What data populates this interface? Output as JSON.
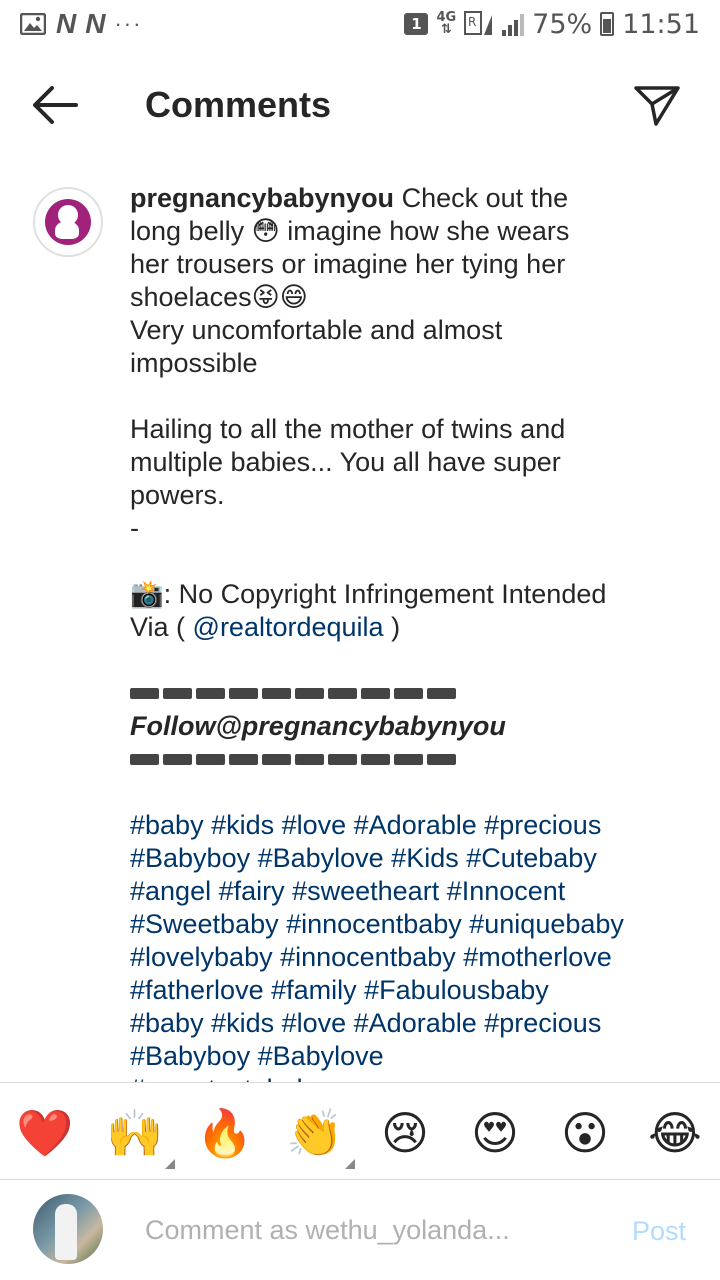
{
  "status_bar": {
    "notif_badge": "1",
    "network": "4G",
    "battery": "75%",
    "time": "11:51",
    "n_icon": "N"
  },
  "header": {
    "title": "Comments",
    "back_icon": "arrow-left-icon",
    "send_icon": "paper-plane-icon"
  },
  "comment": {
    "username": "pregnancybabynyou",
    "lines": [
      " Check out the",
      "long belly 😳 imagine how she wears",
      "her trousers or imagine her tying her",
      "shoelaces😝😄",
      "Very uncomfortable and almost",
      "impossible",
      "",
      "Hailing to all the mother of twins and",
      "multiple babies... You all have super",
      "powers.",
      "-",
      "",
      "📸: No Copyright Infringement Intended"
    ],
    "via_prefix": "Via ( ",
    "via_mention": "@realtordequila",
    "via_suffix": " )",
    "follow": "Follow@pregnancybabynyou",
    "hashtags": [
      " #baby #kids #love #Adorable #precious",
      "#Babyboy #Babylove #Kids #Cutebaby",
      "#angel #fairy #sweetheart #Innocent",
      "#Sweetbaby #innocentbaby #uniquebaby",
      "#lovelybaby #innocentbaby #motherlove",
      "#fatherlove #family #Fabulousbaby",
      "#baby #kids #love #Adorable #precious",
      "#Babyboy #Babylove",
      "#sweetcutebaby"
    ]
  },
  "emoji_bar": [
    {
      "glyph": "❤️",
      "name": "red-heart-emoji"
    },
    {
      "glyph": "🙌",
      "name": "raising-hands-emoji"
    },
    {
      "glyph": "🔥",
      "name": "fire-emoji"
    },
    {
      "glyph": "👏",
      "name": "clapping-hands-emoji"
    },
    {
      "glyph": "😢",
      "name": "crying-face-emoji"
    },
    {
      "glyph": "😍",
      "name": "heart-eyes-emoji"
    },
    {
      "glyph": "😮",
      "name": "surprised-face-emoji"
    },
    {
      "glyph": "😂",
      "name": "tears-of-joy-emoji"
    }
  ],
  "input": {
    "placeholder": "Comment as wethu_yolanda...",
    "post_label": "Post"
  },
  "colors": {
    "link": "#003569",
    "post_disabled": "#b3dbff",
    "brand_avatar": "#a1227b"
  }
}
